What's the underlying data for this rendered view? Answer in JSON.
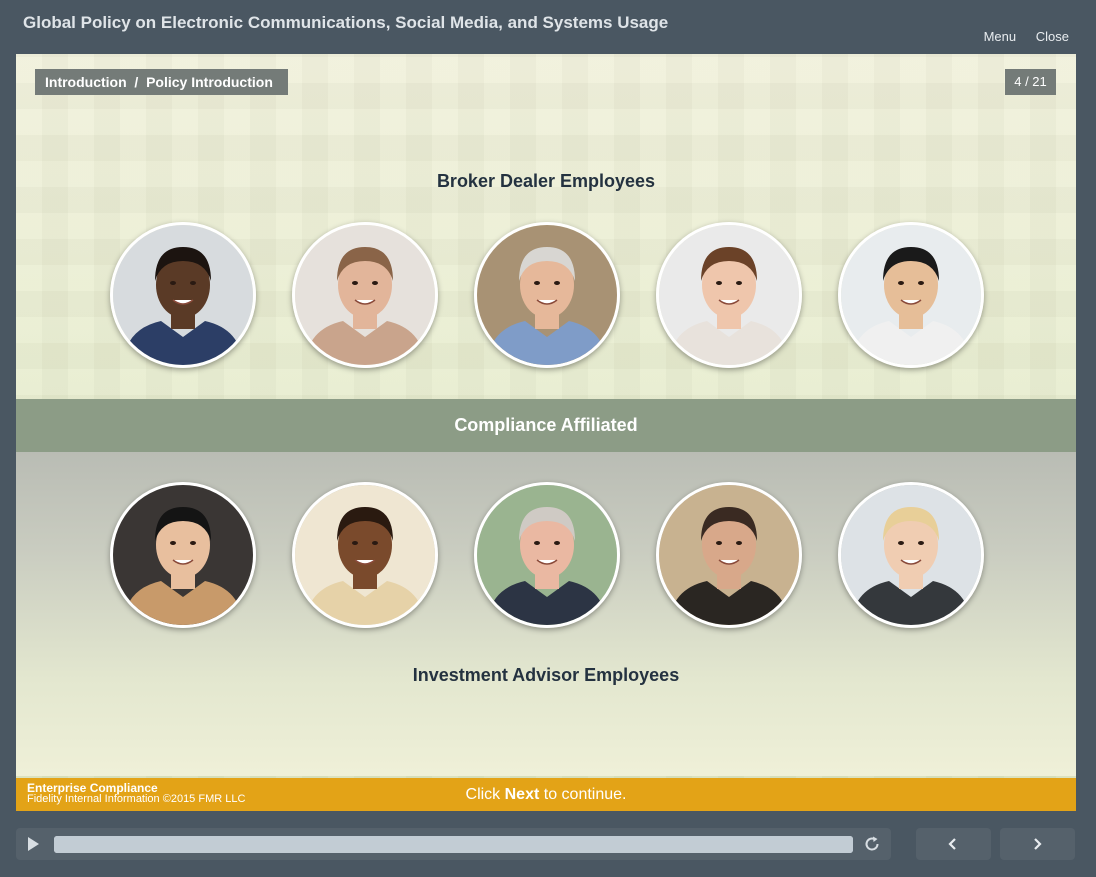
{
  "header": {
    "title": "Global Policy on Electronic Communications, Social Media, and Systems Usage",
    "menu_label": "Menu",
    "close_label": "Close"
  },
  "slide": {
    "breadcrumb": "Introduction  /  Policy Introduction",
    "counter": "4 / 21",
    "top_group_label": "Broker Dealer Employees",
    "middle_bar_label": "Compliance Affiliated",
    "bottom_group_label": "Investment Advisor Employees",
    "top_people": [
      {
        "skin": "#5a3a26",
        "hair": "#1c1410",
        "shirt": "#2c3e66",
        "bg": "#d7dbde"
      },
      {
        "skin": "#e2b59a",
        "hair": "#8a6448",
        "shirt": "#c9a48c",
        "bg": "#e6e1dc"
      },
      {
        "skin": "#e6b89a",
        "hair": "#d8d6d2",
        "shirt": "#7f9cc8",
        "bg": "#a89274"
      },
      {
        "skin": "#efc6ac",
        "hair": "#6b4228",
        "shirt": "#e8e2dc",
        "bg": "#eaeaea"
      },
      {
        "skin": "#e6be98",
        "hair": "#1a1a1a",
        "shirt": "#f0f0f0",
        "bg": "#e8ecee"
      }
    ],
    "bottom_people": [
      {
        "skin": "#e8bf9e",
        "hair": "#141414",
        "shirt": "#c89a6a",
        "bg": "#3a3634"
      },
      {
        "skin": "#7a4a2c",
        "hair": "#2a1a10",
        "shirt": "#e6d2a8",
        "bg": "#efe6d2"
      },
      {
        "skin": "#eab8a2",
        "hair": "#cfcac4",
        "shirt": "#2c3444",
        "bg": "#9ab490"
      },
      {
        "skin": "#d8a88a",
        "hair": "#3a2a22",
        "shirt": "#2a2622",
        "bg": "#c8b290"
      },
      {
        "skin": "#f0cdb2",
        "hair": "#e8cf98",
        "shirt": "#34383c",
        "bg": "#dde2e6"
      }
    ]
  },
  "footer": {
    "org": "Enterprise Compliance",
    "classification": "Fidelity Internal Information ©2015 FMR LLC",
    "prompt_prefix": "Click ",
    "prompt_bold": "Next",
    "prompt_suffix": " to continue."
  },
  "player": {
    "progress": 1.0
  },
  "icons": {
    "play": "play-icon",
    "replay": "replay-icon",
    "prev": "chevron-left-icon",
    "next": "chevron-right-icon"
  }
}
